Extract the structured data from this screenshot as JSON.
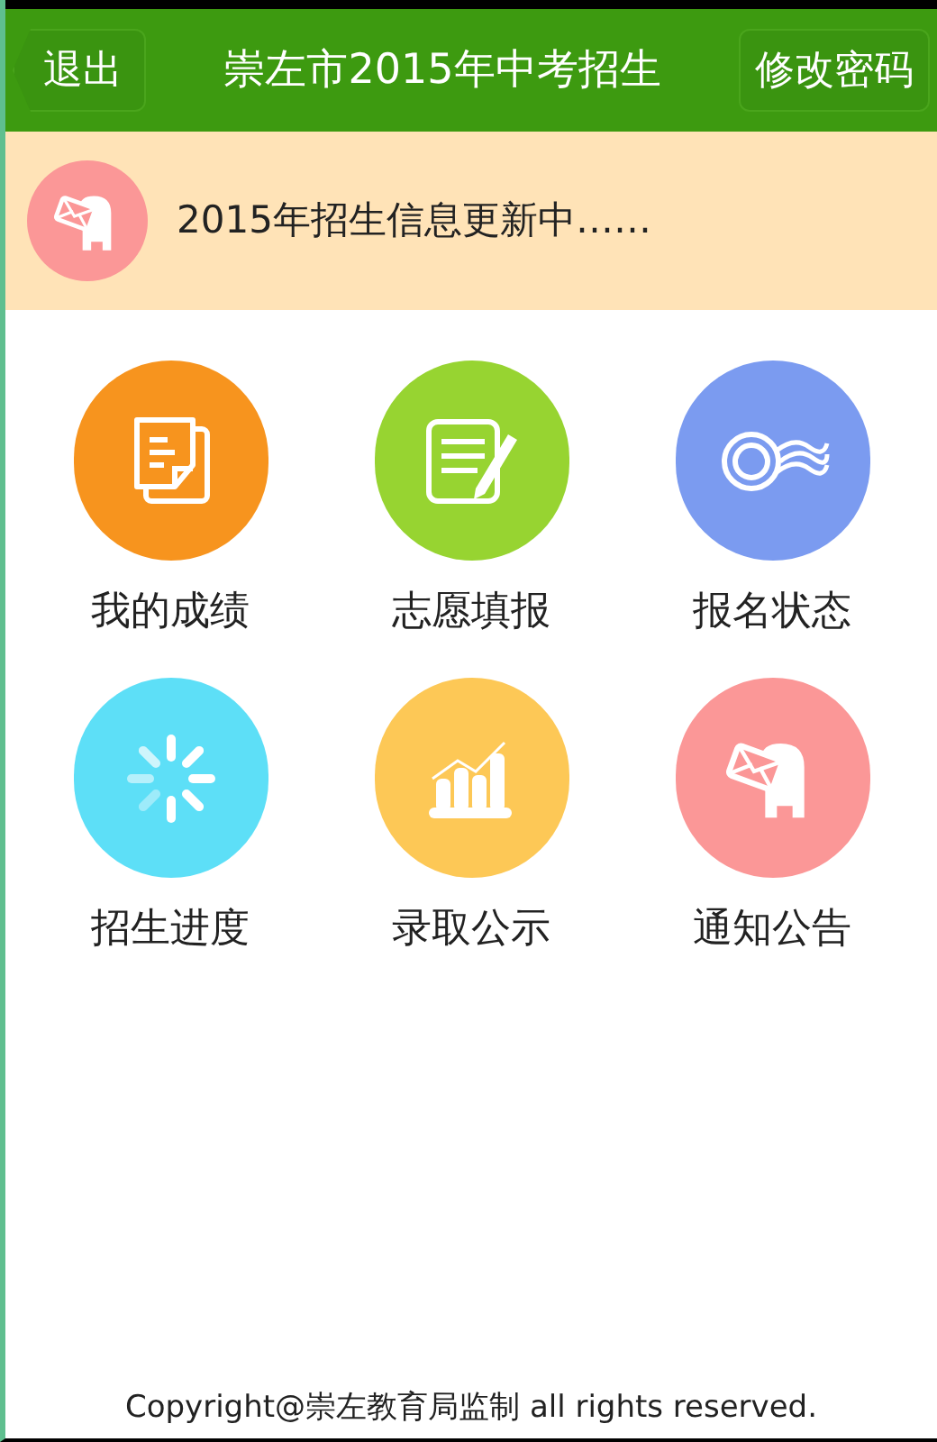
{
  "header": {
    "back_button": "退出",
    "title": "崇左市2015年中考招生",
    "action_button": "修改密码"
  },
  "notice": {
    "text": "2015年招生信息更新中……"
  },
  "tiles": [
    {
      "label": "我的成绩",
      "kind": "documents",
      "color": "#f7941e"
    },
    {
      "label": "志愿填报",
      "kind": "edit",
      "color": "#97d431"
    },
    {
      "label": "报名状态",
      "kind": "stamp",
      "color": "#7b9bf0"
    },
    {
      "label": "招生进度",
      "kind": "spinner",
      "color": "#5ddff7"
    },
    {
      "label": "录取公示",
      "kind": "chart",
      "color": "#fdc856"
    },
    {
      "label": "通知公告",
      "kind": "mailbox",
      "color": "#fb9797"
    }
  ],
  "footer": "Copyright@崇左教育局监制 all rights reserved."
}
